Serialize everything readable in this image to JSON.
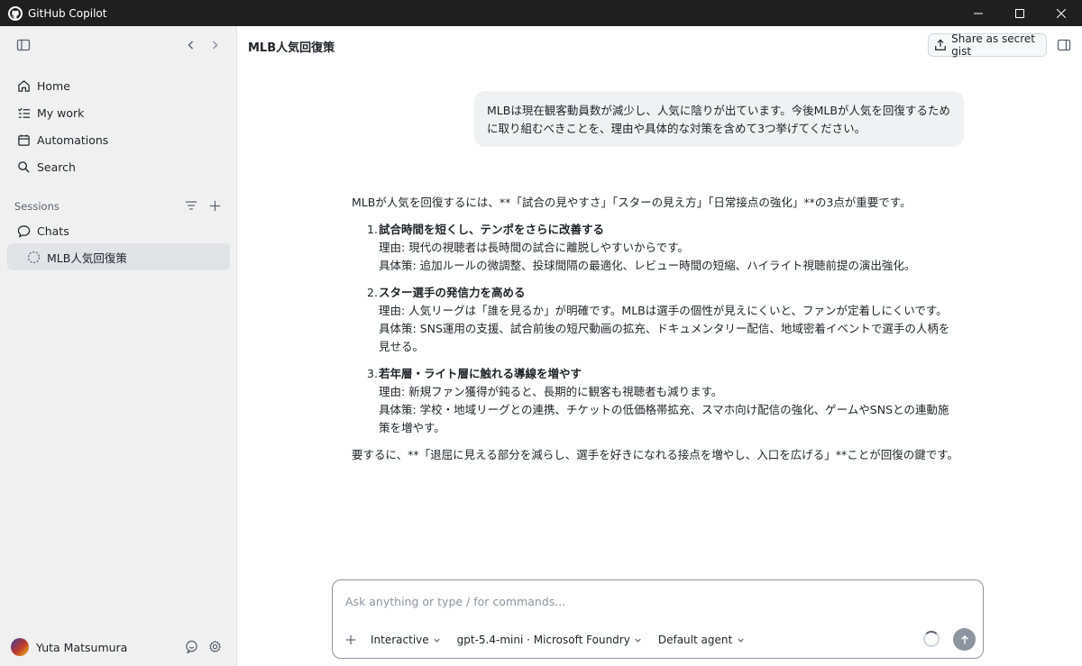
{
  "window": {
    "title": "GitHub Copilot",
    "controls": [
      "minimize-icon",
      "maximize-icon",
      "close-icon"
    ]
  },
  "sidebar": {
    "nav": [
      {
        "label": "Home",
        "icon": "home-icon"
      },
      {
        "label": "My work",
        "icon": "checklist-icon"
      },
      {
        "label": "Automations",
        "icon": "calendar-icon"
      },
      {
        "label": "Search",
        "icon": "search-icon"
      }
    ],
    "sessions_label": "Sessions",
    "chats_label": "Chats",
    "active_session": "MLB人気回復策",
    "user_name": "Yuta Matsumura"
  },
  "header": {
    "title": "MLB人気回復策",
    "share_label": "Share as secret gist"
  },
  "conversation": {
    "user_message": "MLBは現在観客動員数が減少し、人気に陰りが出ています。今後MLBが人気を回復するために取り組むべきことを、理由や具体的な対策を含めて3つ挙げてください。",
    "assistant": {
      "intro": "MLBが人気を回復するには、**「試合の見やすさ」「スターの見え方」「日常接点の強化」**の3点が重要です。",
      "items": [
        {
          "num": "1.",
          "title": "試合時間を短くし、テンポをさらに改善する",
          "reason": "理由: 現代の視聴者は長時間の試合に離脱しやすいからです。",
          "measures": "具体策: 追加ルールの微調整、投球間隔の最適化、レビュー時間の短縮、ハイライト視聴前提の演出強化。"
        },
        {
          "num": "2.",
          "title": "スター選手の発信力を高める",
          "reason": "理由: 人気リーグは「誰を見るか」が明確です。MLBは選手の個性が見えにくいと、ファンが定着しにくいです。",
          "measures": "具体策: SNS運用の支援、試合前後の短尺動画の拡充、ドキュメンタリー配信、地域密着イベントで選手の人柄を見せる。"
        },
        {
          "num": "3.",
          "title": "若年層・ライト層に触れる導線を増やす",
          "reason": "理由: 新規ファン獲得が鈍ると、長期的に観客も視聴者も減ります。",
          "measures": "具体策: 学校・地域リーグとの連携、チケットの低価格帯拡充、スマホ向け配信の強化、ゲームやSNSとの連動施策を増やす。"
        }
      ],
      "outro": "要するに、**「退屈に見える部分を減らし、選手を好きになれる接点を増やし、入口を広げる」**ことが回復の鍵です。"
    }
  },
  "composer": {
    "placeholder": "Ask anything or type / for commands...",
    "value": "",
    "mode": "Interactive",
    "model": "gpt-5.4-mini · Microsoft Foundry",
    "agent": "Default agent"
  }
}
